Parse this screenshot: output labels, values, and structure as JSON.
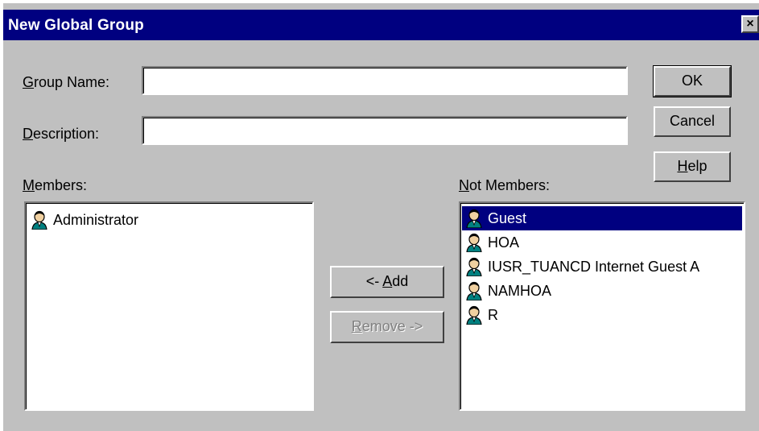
{
  "window": {
    "title": "New Global Group",
    "close_label": "×"
  },
  "form": {
    "group_name_label": "Group Name:",
    "group_name_value": "",
    "description_label": "Description:",
    "description_value": ""
  },
  "buttons": {
    "ok": "OK",
    "cancel": "Cancel",
    "help": "Help",
    "add": "<- Add",
    "remove": "Remove ->"
  },
  "members": {
    "label": "Members:",
    "items": [
      "Administrator"
    ]
  },
  "not_members": {
    "label": "Not Members:",
    "selected": "Guest",
    "items": [
      "Guest",
      "HOA",
      "IUSR_TUANCD Internet Guest A",
      "NAMHOA",
      "R"
    ]
  },
  "colors": {
    "titlebar": "#000080",
    "face": "#c0c0c0",
    "selection": "#000080"
  },
  "icons": {
    "list_user": "user-account-icon"
  }
}
